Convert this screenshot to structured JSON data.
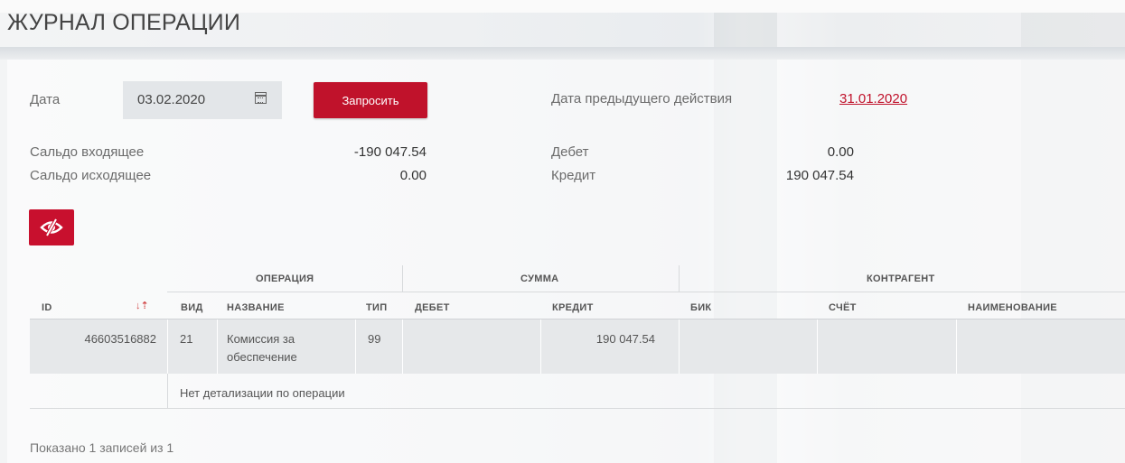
{
  "page": {
    "title": "ЖУРНАЛ ОПЕРАЦИИ"
  },
  "filters": {
    "date_label": "Дата",
    "date_value": "03.02.2020",
    "request_button": "Запросить",
    "prev_action_label": "Дата предыдущего действия",
    "prev_action_date": "31.01.2020"
  },
  "summary": {
    "incoming_balance_label": "Сальдо входящее",
    "incoming_balance_value": "-190 047.54",
    "outgoing_balance_label": "Сальдо исходящее",
    "outgoing_balance_value": "0.00",
    "debit_label": "Дебет",
    "debit_value": "0.00",
    "credit_label": "Кредит",
    "credit_value": "190 047.54"
  },
  "table": {
    "group_headers": {
      "operation": "ОПЕРАЦИЯ",
      "amount": "СУММА",
      "counterparty": "КОНТРАГЕНТ"
    },
    "columns": {
      "id": "ID",
      "kind": "ВИД",
      "name": "НАЗВАНИЕ",
      "type": "ТИП",
      "debit": "ДЕБЕТ",
      "credit": "КРЕДИТ",
      "bik": "БИК",
      "account": "СЧЁТ",
      "title": "НАИМЕНОВАНИЕ"
    },
    "rows": [
      {
        "id": "46603516882",
        "kind": "21",
        "name_line1": "Комиссия за",
        "name_line2": "обеспечение",
        "type": "99",
        "debit": "",
        "credit": "190 047.54",
        "bik": "",
        "account": "",
        "title": ""
      }
    ],
    "detail_note": "Нет детализации по операции"
  },
  "footer": {
    "shown_text": "Показано 1 записей из 1"
  },
  "colors": {
    "accent": "#c0122b"
  },
  "icons": {
    "calendar": "calendar-icon",
    "hide": "eye-off-icon",
    "sort": "sort-desc-icon"
  }
}
